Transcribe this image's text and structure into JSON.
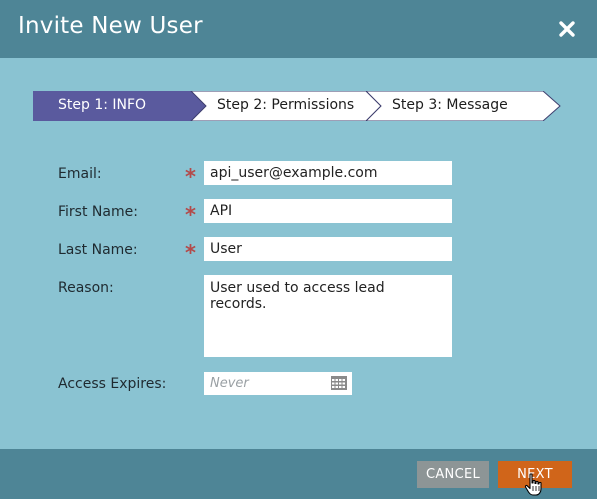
{
  "dialog": {
    "title": "Invite New User",
    "close_icon": "close-icon"
  },
  "wizard": {
    "steps": [
      {
        "label": "Step 1: INFO",
        "active": true
      },
      {
        "label": "Step 2: Permissions",
        "active": false
      },
      {
        "label": "Step 3: Message",
        "active": false
      }
    ]
  },
  "form": {
    "email": {
      "label": "Email:",
      "value": "api_user@example.com",
      "required_mark": "*"
    },
    "first_name": {
      "label": "First Name:",
      "value": "API",
      "required_mark": "*"
    },
    "last_name": {
      "label": "Last Name:",
      "value": "User",
      "required_mark": "*"
    },
    "reason": {
      "label": "Reason:",
      "value": "User used to access lead  records."
    },
    "access_expires": {
      "label": "Access Expires:",
      "placeholder": "Never",
      "icon": "calendar-icon"
    }
  },
  "footer": {
    "cancel_label": "CANCEL",
    "next_label": "NEXT"
  },
  "colors": {
    "titlebar": "#4e8596",
    "body": "#8ac3d2",
    "active_step": "#5a5a9e",
    "required": "#b34a4a",
    "next_button": "#d0651a",
    "cancel_button": "#8d9596"
  }
}
